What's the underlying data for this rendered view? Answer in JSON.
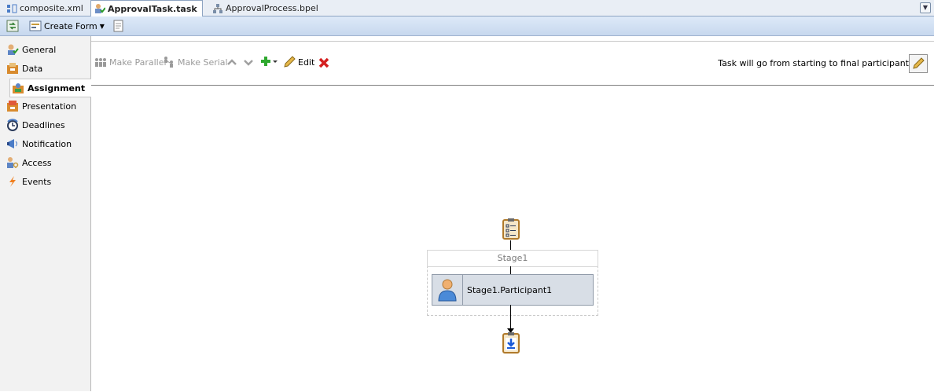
{
  "tabs": [
    {
      "label": "composite.xml",
      "icon": "composite-icon",
      "active": false
    },
    {
      "label": "ApprovalTask.task",
      "icon": "task-icon",
      "active": true
    },
    {
      "label": "ApprovalProcess.bpel",
      "icon": "bpel-icon",
      "active": false
    }
  ],
  "toolbar": {
    "create_form_label": "Create Form"
  },
  "sidenav": {
    "items": [
      {
        "label": "General",
        "icon": "general-icon"
      },
      {
        "label": "Data",
        "icon": "data-icon"
      },
      {
        "label": "Assignment",
        "icon": "assignment-icon",
        "active": true
      },
      {
        "label": "Presentation",
        "icon": "presentation-icon"
      },
      {
        "label": "Deadlines",
        "icon": "deadlines-icon"
      },
      {
        "label": "Notification",
        "icon": "notification-icon"
      },
      {
        "label": "Access",
        "icon": "access-icon"
      },
      {
        "label": "Events",
        "icon": "events-icon"
      }
    ]
  },
  "assignment_toolbar": {
    "make_parallel": "Make Parallel",
    "make_serial": "Make Serial",
    "edit": "Edit",
    "routing_note": "Task will go from starting to final participant"
  },
  "diagram": {
    "stage_name": "Stage1",
    "participant_name": "Stage1.Participant1"
  },
  "colors": {
    "accent": "#c7d8ee",
    "delete": "#d41f1f",
    "add": "#2fa82f"
  }
}
